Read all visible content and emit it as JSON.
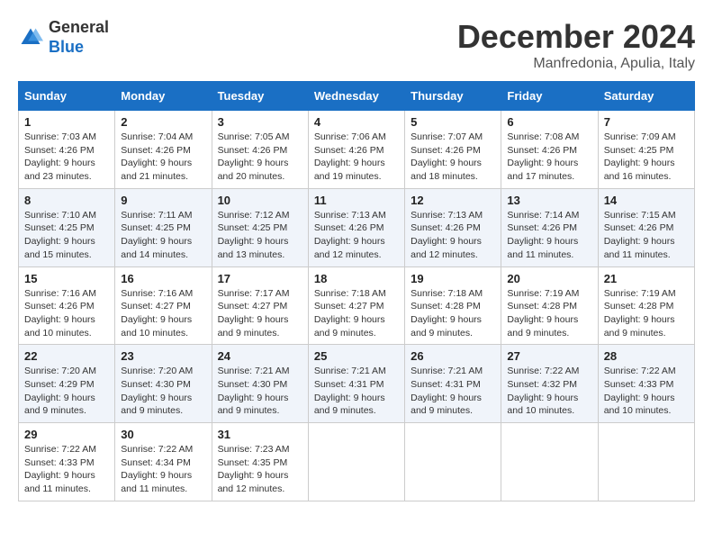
{
  "header": {
    "logo": {
      "general": "General",
      "blue": "Blue"
    },
    "title": "December 2024",
    "location": "Manfredonia, Apulia, Italy"
  },
  "calendar": {
    "days_of_week": [
      "Sunday",
      "Monday",
      "Tuesday",
      "Wednesday",
      "Thursday",
      "Friday",
      "Saturday"
    ],
    "weeks": [
      [
        null,
        {
          "day": "2",
          "sunrise": "Sunrise: 7:04 AM",
          "sunset": "Sunset: 4:26 PM",
          "daylight": "Daylight: 9 hours and 21 minutes."
        },
        {
          "day": "3",
          "sunrise": "Sunrise: 7:05 AM",
          "sunset": "Sunset: 4:26 PM",
          "daylight": "Daylight: 9 hours and 20 minutes."
        },
        {
          "day": "4",
          "sunrise": "Sunrise: 7:06 AM",
          "sunset": "Sunset: 4:26 PM",
          "daylight": "Daylight: 9 hours and 19 minutes."
        },
        {
          "day": "5",
          "sunrise": "Sunrise: 7:07 AM",
          "sunset": "Sunset: 4:26 PM",
          "daylight": "Daylight: 9 hours and 18 minutes."
        },
        {
          "day": "6",
          "sunrise": "Sunrise: 7:08 AM",
          "sunset": "Sunset: 4:26 PM",
          "daylight": "Daylight: 9 hours and 17 minutes."
        },
        {
          "day": "7",
          "sunrise": "Sunrise: 7:09 AM",
          "sunset": "Sunset: 4:25 PM",
          "daylight": "Daylight: 9 hours and 16 minutes."
        }
      ],
      [
        {
          "day": "1",
          "sunrise": "Sunrise: 7:03 AM",
          "sunset": "Sunset: 4:26 PM",
          "daylight": "Daylight: 9 hours and 23 minutes."
        },
        null,
        null,
        null,
        null,
        null,
        null
      ],
      [
        {
          "day": "8",
          "sunrise": "Sunrise: 7:10 AM",
          "sunset": "Sunset: 4:25 PM",
          "daylight": "Daylight: 9 hours and 15 minutes."
        },
        {
          "day": "9",
          "sunrise": "Sunrise: 7:11 AM",
          "sunset": "Sunset: 4:25 PM",
          "daylight": "Daylight: 9 hours and 14 minutes."
        },
        {
          "day": "10",
          "sunrise": "Sunrise: 7:12 AM",
          "sunset": "Sunset: 4:25 PM",
          "daylight": "Daylight: 9 hours and 13 minutes."
        },
        {
          "day": "11",
          "sunrise": "Sunrise: 7:13 AM",
          "sunset": "Sunset: 4:26 PM",
          "daylight": "Daylight: 9 hours and 12 minutes."
        },
        {
          "day": "12",
          "sunrise": "Sunrise: 7:13 AM",
          "sunset": "Sunset: 4:26 PM",
          "daylight": "Daylight: 9 hours and 12 minutes."
        },
        {
          "day": "13",
          "sunrise": "Sunrise: 7:14 AM",
          "sunset": "Sunset: 4:26 PM",
          "daylight": "Daylight: 9 hours and 11 minutes."
        },
        {
          "day": "14",
          "sunrise": "Sunrise: 7:15 AM",
          "sunset": "Sunset: 4:26 PM",
          "daylight": "Daylight: 9 hours and 11 minutes."
        }
      ],
      [
        {
          "day": "15",
          "sunrise": "Sunrise: 7:16 AM",
          "sunset": "Sunset: 4:26 PM",
          "daylight": "Daylight: 9 hours and 10 minutes."
        },
        {
          "day": "16",
          "sunrise": "Sunrise: 7:16 AM",
          "sunset": "Sunset: 4:27 PM",
          "daylight": "Daylight: 9 hours and 10 minutes."
        },
        {
          "day": "17",
          "sunrise": "Sunrise: 7:17 AM",
          "sunset": "Sunset: 4:27 PM",
          "daylight": "Daylight: 9 hours and 9 minutes."
        },
        {
          "day": "18",
          "sunrise": "Sunrise: 7:18 AM",
          "sunset": "Sunset: 4:27 PM",
          "daylight": "Daylight: 9 hours and 9 minutes."
        },
        {
          "day": "19",
          "sunrise": "Sunrise: 7:18 AM",
          "sunset": "Sunset: 4:28 PM",
          "daylight": "Daylight: 9 hours and 9 minutes."
        },
        {
          "day": "20",
          "sunrise": "Sunrise: 7:19 AM",
          "sunset": "Sunset: 4:28 PM",
          "daylight": "Daylight: 9 hours and 9 minutes."
        },
        {
          "day": "21",
          "sunrise": "Sunrise: 7:19 AM",
          "sunset": "Sunset: 4:28 PM",
          "daylight": "Daylight: 9 hours and 9 minutes."
        }
      ],
      [
        {
          "day": "22",
          "sunrise": "Sunrise: 7:20 AM",
          "sunset": "Sunset: 4:29 PM",
          "daylight": "Daylight: 9 hours and 9 minutes."
        },
        {
          "day": "23",
          "sunrise": "Sunrise: 7:20 AM",
          "sunset": "Sunset: 4:30 PM",
          "daylight": "Daylight: 9 hours and 9 minutes."
        },
        {
          "day": "24",
          "sunrise": "Sunrise: 7:21 AM",
          "sunset": "Sunset: 4:30 PM",
          "daylight": "Daylight: 9 hours and 9 minutes."
        },
        {
          "day": "25",
          "sunrise": "Sunrise: 7:21 AM",
          "sunset": "Sunset: 4:31 PM",
          "daylight": "Daylight: 9 hours and 9 minutes."
        },
        {
          "day": "26",
          "sunrise": "Sunrise: 7:21 AM",
          "sunset": "Sunset: 4:31 PM",
          "daylight": "Daylight: 9 hours and 9 minutes."
        },
        {
          "day": "27",
          "sunrise": "Sunrise: 7:22 AM",
          "sunset": "Sunset: 4:32 PM",
          "daylight": "Daylight: 9 hours and 10 minutes."
        },
        {
          "day": "28",
          "sunrise": "Sunrise: 7:22 AM",
          "sunset": "Sunset: 4:33 PM",
          "daylight": "Daylight: 9 hours and 10 minutes."
        }
      ],
      [
        {
          "day": "29",
          "sunrise": "Sunrise: 7:22 AM",
          "sunset": "Sunset: 4:33 PM",
          "daylight": "Daylight: 9 hours and 11 minutes."
        },
        {
          "day": "30",
          "sunrise": "Sunrise: 7:22 AM",
          "sunset": "Sunset: 4:34 PM",
          "daylight": "Daylight: 9 hours and 11 minutes."
        },
        {
          "day": "31",
          "sunrise": "Sunrise: 7:23 AM",
          "sunset": "Sunset: 4:35 PM",
          "daylight": "Daylight: 9 hours and 12 minutes."
        },
        null,
        null,
        null,
        null
      ]
    ]
  }
}
